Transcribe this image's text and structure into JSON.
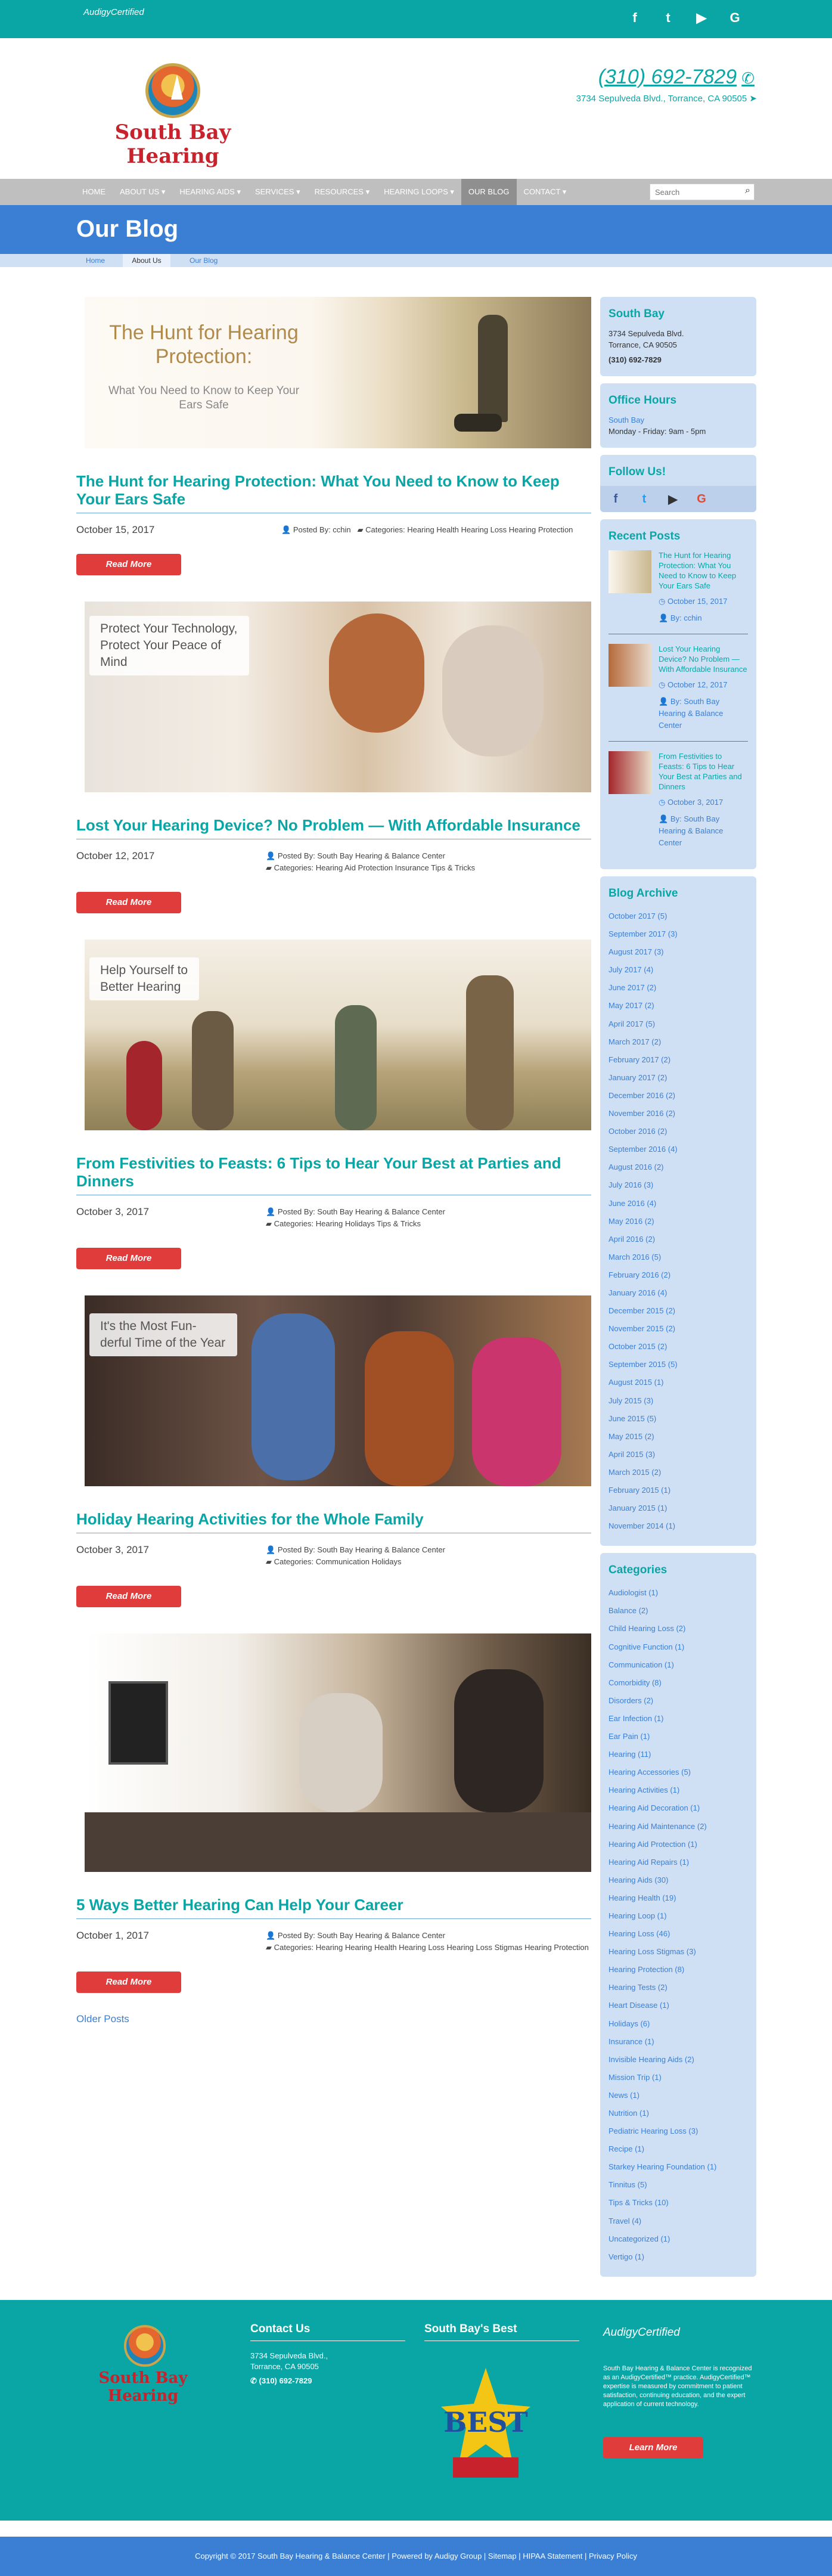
{
  "topbar": {
    "audigy_label": "AudigyCertified",
    "social": [
      "f",
      "t",
      "▶",
      "G"
    ]
  },
  "header": {
    "brand": "South Bay Hearing",
    "phone": "(310) 692-7829",
    "address": "3734 Sepulveda Blvd., Torrance, CA 90505"
  },
  "nav": {
    "items": [
      "HOME",
      "ABOUT US ▾",
      "HEARING AIDS ▾",
      "SERVICES ▾",
      "RESOURCES ▾",
      "HEARING LOOPS ▾",
      "OUR BLOG",
      "CONTACT ▾"
    ],
    "search_placeholder": "Search"
  },
  "banner": {
    "title": "Our Blog"
  },
  "breadcrumb": [
    "Home",
    "About Us",
    "Our Blog"
  ],
  "posts": [
    {
      "image_text": "The Hunt for Hearing Protection:",
      "image_sub": "What You Need to Know to Keep Your Ears Safe",
      "title": "The Hunt for Hearing Protection: What You Need to Know to Keep Your Ears Safe",
      "date": "October 15, 2017",
      "posted_by": "Posted By: cchin",
      "categories": "Categories: Hearing Health Hearing Loss Hearing Protection",
      "read_more": "Read More"
    },
    {
      "image_text": "Protect Your Technology, Protect Your Peace of Mind",
      "title": "Lost Your Hearing Device? No Problem — With Affordable Insurance",
      "date": "October 12, 2017",
      "posted_by": "Posted By: South Bay Hearing & Balance Center",
      "categories": "Categories: Hearing Aid Protection Insurance Tips & Tricks",
      "read_more": "Read More"
    },
    {
      "image_text": "Help Yourself to Better Hearing",
      "title": "From Festivities to Feasts: 6 Tips to Hear Your Best at Parties and Dinners",
      "date": "October 3, 2017",
      "posted_by": "Posted By: South Bay Hearing & Balance Center",
      "categories": "Categories: Hearing Holidays Tips & Tricks",
      "read_more": "Read More"
    },
    {
      "image_text": "It's the Most Fun-derful Time of the Year",
      "title": "Holiday Hearing Activities for the Whole Family",
      "date": "October 3, 2017",
      "posted_by": "Posted By: South Bay Hearing & Balance Center",
      "categories": "Categories: Communication Holidays",
      "read_more": "Read More"
    },
    {
      "image_text": "",
      "title": "5 Ways Better Hearing Can Help Your Career",
      "date": "October 1, 2017",
      "posted_by": "Posted By: South Bay Hearing & Balance Center",
      "categories": "Categories: Hearing Hearing Health Hearing Loss Hearing Loss Stigmas Hearing Protection",
      "read_more": "Read More"
    }
  ],
  "older_posts": "Older Posts",
  "sidebar": {
    "location": {
      "title": "South Bay",
      "line1": "3734 Sepulveda Blvd.",
      "line2": "Torrance, CA 90505",
      "phone": "(310) 692-7829"
    },
    "hours": {
      "title": "Office Hours",
      "location": "South Bay",
      "hours": "Monday - Friday: 9am - 5pm"
    },
    "follow": {
      "title": "Follow Us!",
      "icons": [
        "f",
        "t",
        "▶",
        "G"
      ]
    },
    "recent": {
      "title": "Recent Posts",
      "items": [
        {
          "title": "The Hunt for Hearing Protection: What You Need to Know to Keep Your Ears Safe",
          "date": "October 15, 2017",
          "by": "By: cchin"
        },
        {
          "title": "Lost Your Hearing Device? No Problem — With Affordable Insurance",
          "date": "October 12, 2017",
          "by": "By: South Bay Hearing & Balance Center"
        },
        {
          "title": "From Festivities to Feasts: 6 Tips to Hear Your Best at Parties and Dinners",
          "date": "October 3, 2017",
          "by": "By: South Bay Hearing & Balance Center"
        }
      ]
    },
    "archive": {
      "title": "Blog Archive",
      "items": [
        "October 2017 (5)",
        "September 2017 (3)",
        "August 2017 (3)",
        "July 2017 (4)",
        "June 2017 (2)",
        "May 2017 (2)",
        "April 2017 (5)",
        "March 2017 (2)",
        "February 2017 (2)",
        "January 2017 (2)",
        "December 2016 (2)",
        "November 2016 (2)",
        "October 2016 (2)",
        "September 2016 (4)",
        "August 2016 (2)",
        "July 2016 (3)",
        "June 2016 (4)",
        "May 2016 (2)",
        "April 2016 (2)",
        "March 2016 (5)",
        "February 2016 (2)",
        "January 2016 (4)",
        "December 2015 (2)",
        "November 2015 (2)",
        "October 2015 (2)",
        "September 2015 (5)",
        "August 2015 (1)",
        "July 2015 (3)",
        "June 2015 (5)",
        "May 2015 (2)",
        "April 2015 (3)",
        "March 2015 (2)",
        "February 2015 (1)",
        "January 2015 (1)",
        "November 2014 (1)"
      ]
    },
    "categories": {
      "title": "Categories",
      "items": [
        "Audiologist (1)",
        "Balance (2)",
        "Child Hearing Loss (2)",
        "Cognitive Function (1)",
        "Communication (1)",
        "Comorbidity (8)",
        "Disorders (2)",
        "Ear Infection (1)",
        "Ear Pain (1)",
        "Hearing (11)",
        "Hearing Accessories (5)",
        "Hearing Activities (1)",
        "Hearing Aid Decoration (1)",
        "Hearing Aid Maintenance (2)",
        "Hearing Aid Protection (1)",
        "Hearing Aid Repairs (1)",
        "Hearing Aids (30)",
        "Hearing Health (19)",
        "Hearing Loop (1)",
        "Hearing Loss (46)",
        "Hearing Loss Stigmas (3)",
        "Hearing Protection (8)",
        "Hearing Tests (2)",
        "Heart Disease (1)",
        "Holidays (6)",
        "Insurance (1)",
        "Invisible Hearing Aids (2)",
        "Mission Trip (1)",
        "News (1)",
        "Nutrition (1)",
        "Pediatric Hearing Loss (3)",
        "Recipe (1)",
        "Starkey Hearing Foundation (1)",
        "Tinnitus (5)",
        "Tips & Tricks (10)",
        "Travel (4)",
        "Uncategorized (1)",
        "Vertigo (1)"
      ]
    }
  },
  "footer": {
    "brand": "South Bay Hearing",
    "contact_title": "Contact Us",
    "contact_line1": "3734 Sepulveda Blvd.,",
    "contact_line2": "Torrance, CA 90505",
    "contact_phone": "(310) 692-7829",
    "best_title": "South Bay's Best",
    "best_badge": "BEST",
    "audigy_label": "AudigyCertified",
    "audigy_text": "South Bay Hearing & Balance Center is recognized as an AudigyCertified™ practice. AudigyCertified™ expertise is measured by commitment to patient satisfaction, continuing education, and the expert application of current technology.",
    "learn_more": "Learn More",
    "copyright": "Copyright © 2017 South Bay Hearing & Balance Center   |   Powered by Audigy Group   |   Sitemap   |   HIPAA Statement   |   Privacy Policy"
  }
}
